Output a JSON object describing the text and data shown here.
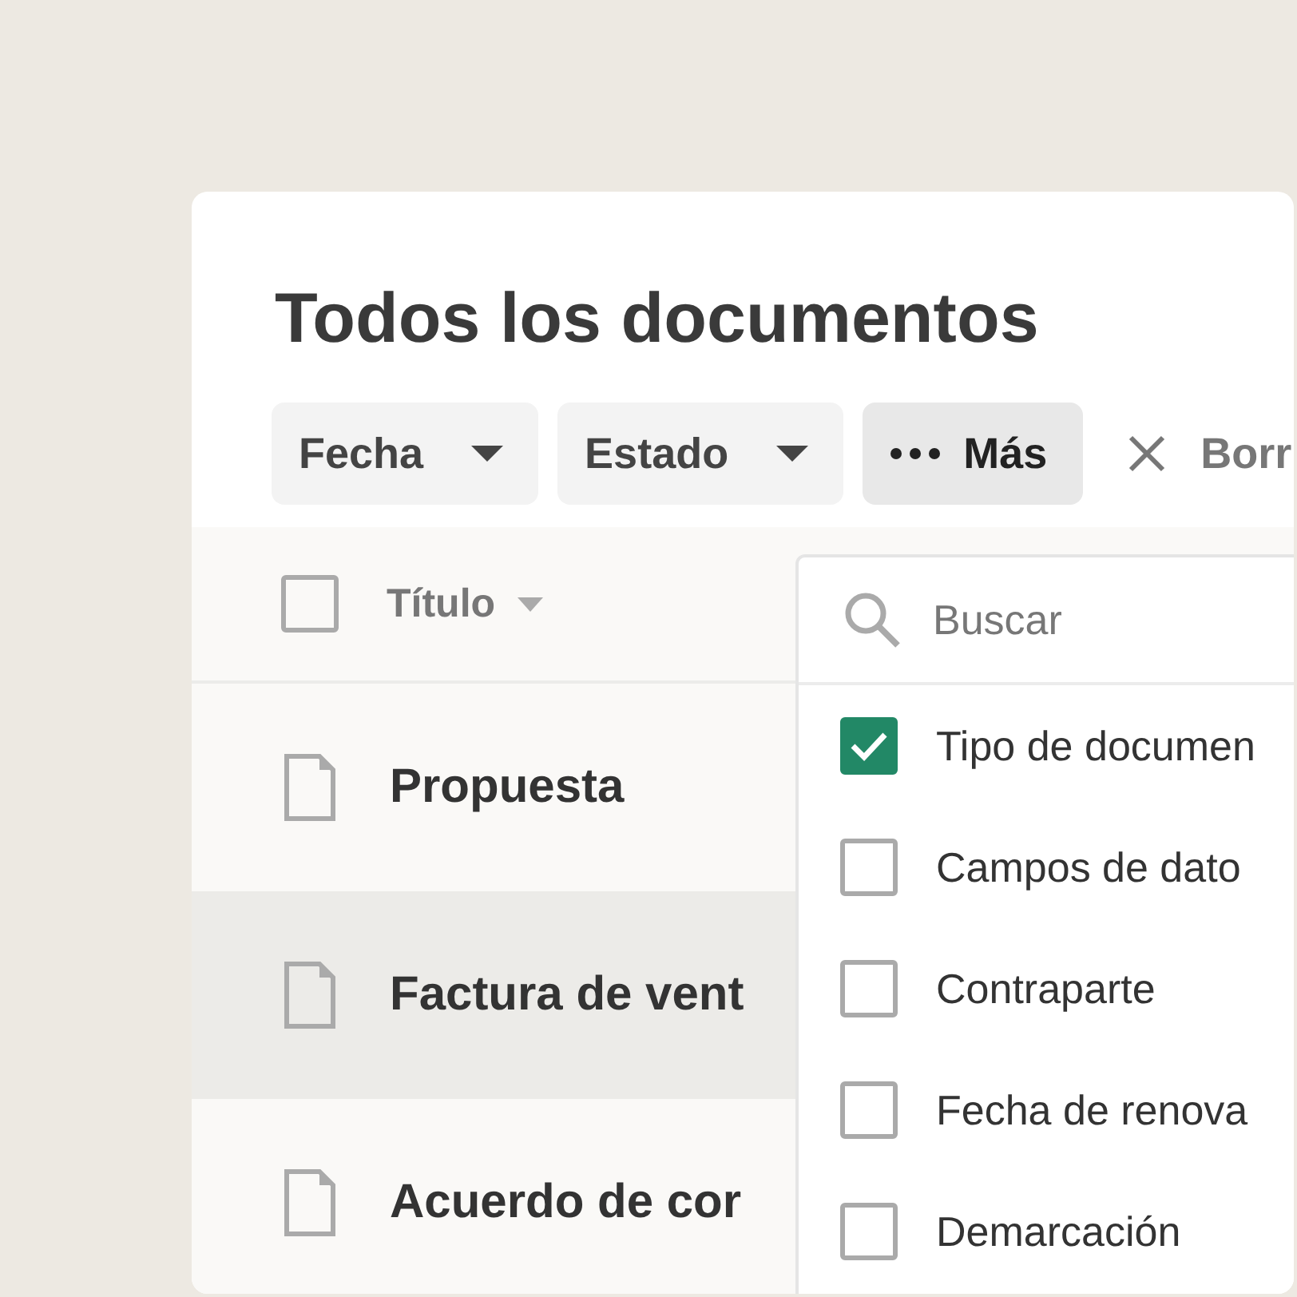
{
  "page": {
    "title": "Todos los documentos"
  },
  "filters": [
    {
      "label": "Fecha",
      "kind": "dropdown",
      "selected": false
    },
    {
      "label": "Estado",
      "kind": "dropdown",
      "selected": false
    },
    {
      "label": "Más",
      "kind": "more",
      "selected": true
    },
    {
      "label": "Borr",
      "kind": "clear",
      "selected": false
    }
  ],
  "table": {
    "select_all": {
      "checked": false
    },
    "column": {
      "label": "Título"
    },
    "rows": [
      {
        "title": "Propuesta",
        "highlighted": false
      },
      {
        "title": "Factura de vent",
        "highlighted": true
      },
      {
        "title": "Acuerdo de cor",
        "highlighted": false
      }
    ]
  },
  "dropdown": {
    "search": {
      "placeholder": "Buscar"
    },
    "options": [
      {
        "label": "Tipo de documen",
        "checked": true
      },
      {
        "label": "Campos de dato",
        "checked": false
      },
      {
        "label": "Contraparte",
        "checked": false
      },
      {
        "label": "Fecha de renova",
        "checked": false
      },
      {
        "label": "Demarcación",
        "checked": false
      }
    ]
  }
}
